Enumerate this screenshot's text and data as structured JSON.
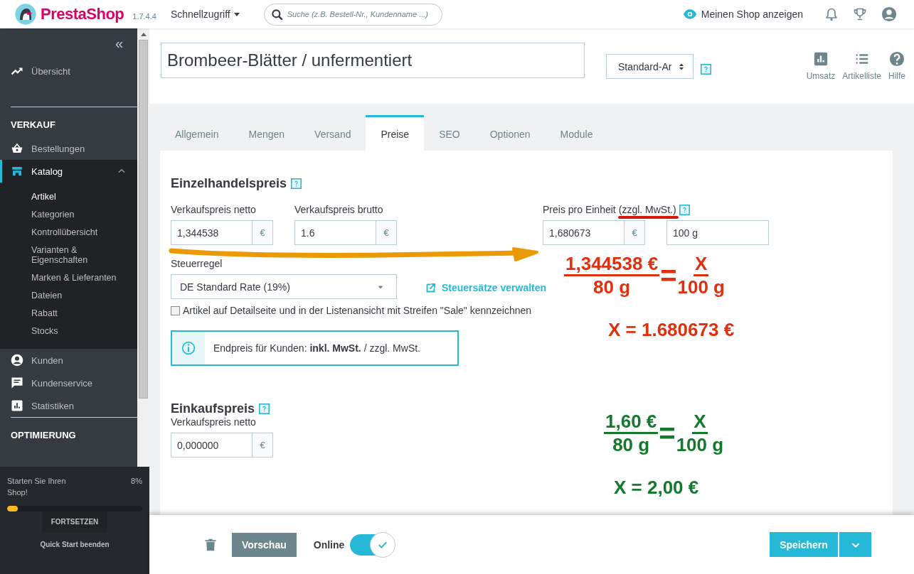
{
  "topbar": {
    "logo": "PrestaShop",
    "version": "1.7.4.4",
    "quick_access": "Schnellzugriff",
    "search": {
      "placeholder": "Suche (z.B. Bestell-Nr., Kundenname ...)"
    },
    "view_shop": "Meinen Shop anzeigen"
  },
  "sidebar": {
    "collapse": "«",
    "sections": [
      {
        "items": [
          {
            "label": "Übersicht",
            "selected": false
          }
        ]
      },
      {
        "title": "VERKAUF",
        "items": [
          {
            "label": "Bestellungen",
            "selected": false
          },
          {
            "label": "Katalog",
            "selected": true,
            "expanded": true,
            "children": [
              {
                "label": "Artikel",
                "selected": true
              },
              {
                "label": "Kategorien",
                "selected": false
              },
              {
                "label": "Kontrollübersicht",
                "selected": false
              },
              {
                "label": "Varianten & Eigenschaften",
                "selected": false
              },
              {
                "label": "Marken & Lieferanten",
                "selected": false
              },
              {
                "label": "Dateien",
                "selected": false
              },
              {
                "label": "Rabatt",
                "selected": false
              },
              {
                "label": "Stocks",
                "selected": false
              }
            ]
          },
          {
            "label": "Kunden",
            "selected": false
          },
          {
            "label": "Kundenservice",
            "selected": false
          },
          {
            "label": "Statistiken",
            "selected": false
          }
        ]
      },
      {
        "title": "OPTIMIERUNG"
      }
    ]
  },
  "quick_start": {
    "title": "Starten Sie Ihren Shop!",
    "percent": "8%",
    "level": 0.08,
    "button": "FORTSETZEN",
    "link": "Quick Start beenden"
  },
  "product": {
    "name": "Brombeer-Blätter / unfermentiert",
    "type_select": "Standard-Ar"
  },
  "toolbar": [
    {
      "label": "Umsatz"
    },
    {
      "label": "Artikelliste"
    },
    {
      "label": "Hilfe"
    }
  ],
  "tabs": [
    {
      "label": "Allgemein",
      "selected": false
    },
    {
      "label": "Mengen",
      "selected": false
    },
    {
      "label": "Versand",
      "selected": false
    },
    {
      "label": "Preise",
      "selected": true
    },
    {
      "label": "SEO",
      "selected": false
    },
    {
      "label": "Optionen",
      "selected": false
    },
    {
      "label": "Module",
      "selected": false
    }
  ],
  "retail": {
    "heading": "Einzelhandelspreis",
    "net": {
      "label": "Verkaufspreis netto",
      "value": "1,344538",
      "unit": "€"
    },
    "gross": {
      "label": "Verkaufspreis brutto",
      "value": "1.6",
      "unit": "€"
    },
    "unit_price": {
      "label": "Preis pro Einheit",
      "label_note": "(zzgl. MwSt.)",
      "value": "1,680673",
      "currency": "€",
      "unit": "100 g"
    },
    "tax_rule": {
      "label": "Steuerregel",
      "value": "DE Standard Rate (19%)"
    },
    "manage_link": "Steuersätze verwalten",
    "sale_checkbox": {
      "label": "Artikel auf Detailseite und in der Listenansicht mit Streifen \"Sale\" kennzeichnen",
      "checked": false
    },
    "info": "Endpreis für Kunden: **inkl. MwSt.** / zzgl. MwSt."
  },
  "wholesale": {
    "heading": "Einkaufspreis",
    "field": {
      "label": "Verkaufspreis netto",
      "value": "0,000000",
      "unit": "€"
    }
  },
  "annotations": [
    {
      "color": "#e0300e",
      "numerator": "1,344538 €",
      "denominator": "80 g",
      "equals": "=",
      "rhs_numerator": "X",
      "rhs_denominator": "100 g",
      "result": "X = 1.680673 €"
    },
    {
      "color": "#137a2c",
      "numerator": "1,60 €",
      "denominator": "80 g",
      "equals": "=",
      "rhs_numerator": "X",
      "rhs_denominator": "100 g",
      "result": "X = 2,00 €"
    }
  ],
  "footer": {
    "preview": "Vorschau",
    "online": {
      "label": "Online",
      "on": true
    },
    "save": "Speichern"
  }
}
